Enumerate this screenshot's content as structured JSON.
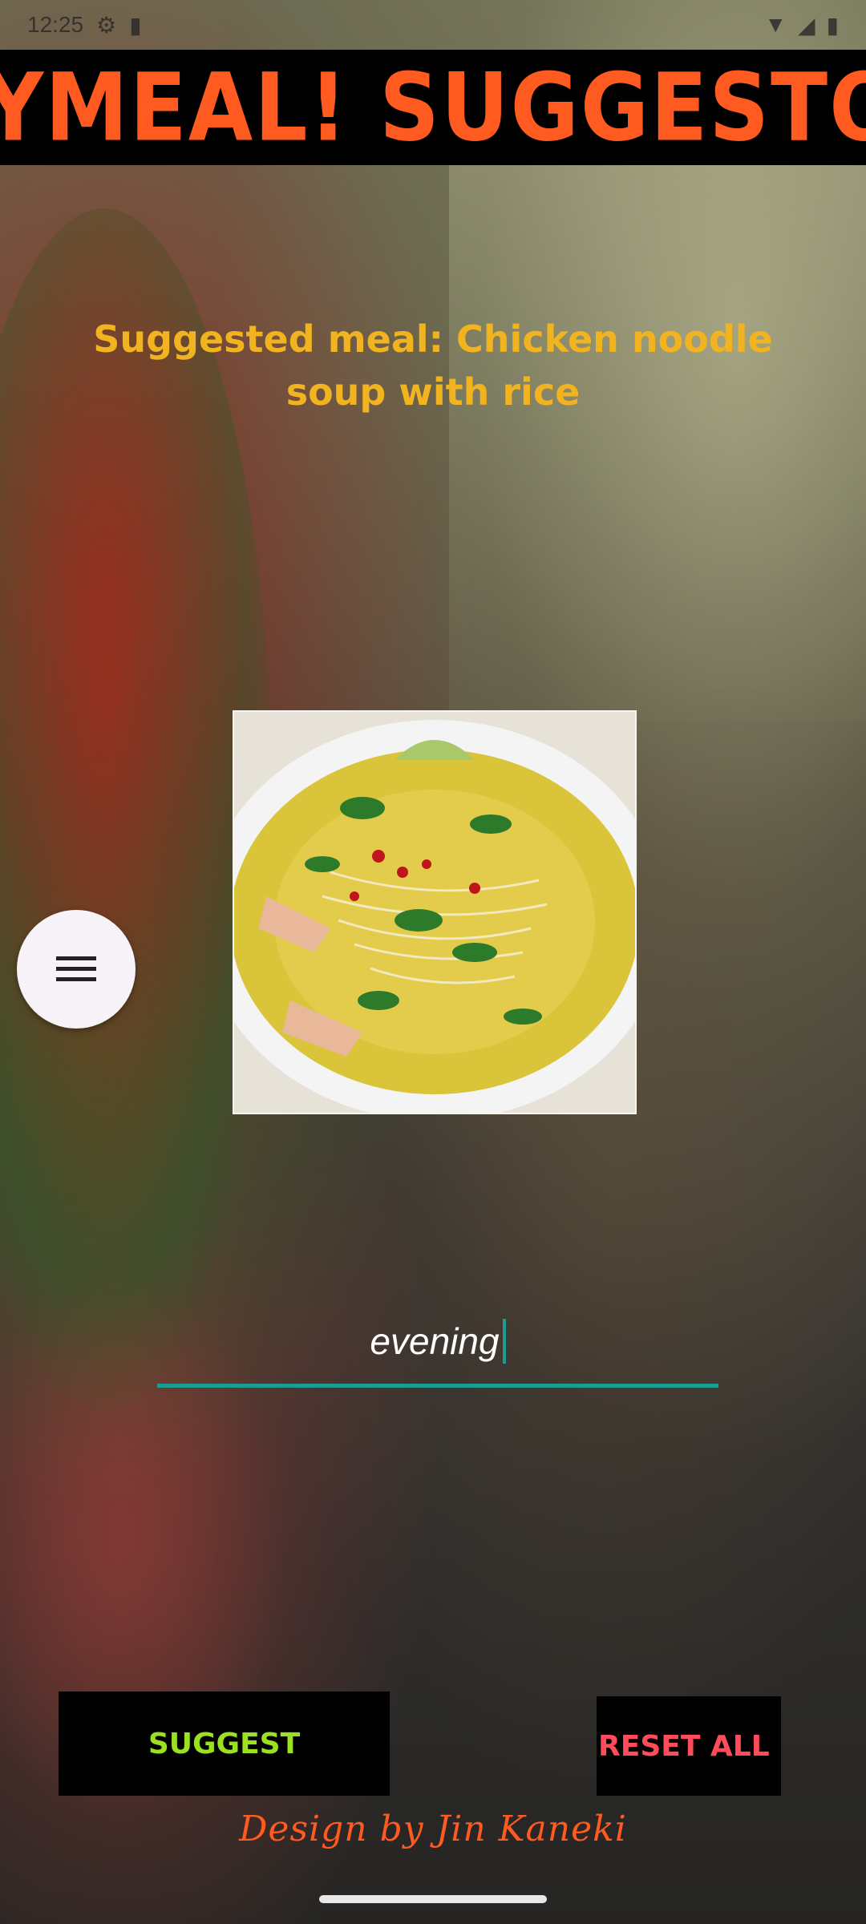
{
  "status_bar": {
    "time": "12:25",
    "icons": [
      "settings-icon",
      "sim-icon",
      "wifi-icon",
      "signal-icon",
      "battery-icon"
    ]
  },
  "header": {
    "title": "MYMEAL! SUGGESTOR"
  },
  "main": {
    "suggestion_text": "Suggested meal: Chicken noodle soup with rice",
    "image_alt": "chicken noodle soup bowl",
    "input_value": "evening"
  },
  "buttons": {
    "suggest_label": "SUGGEST",
    "reset_label": "RESET ALL"
  },
  "footer": {
    "credit": "Design by Jin Kaneki"
  },
  "colors": {
    "title": "#ff5a1f",
    "suggestion": "#f2b321",
    "suggest_button": "#9be021",
    "reset_button": "#ff4b5a",
    "input_underline": "#1a9e94"
  }
}
